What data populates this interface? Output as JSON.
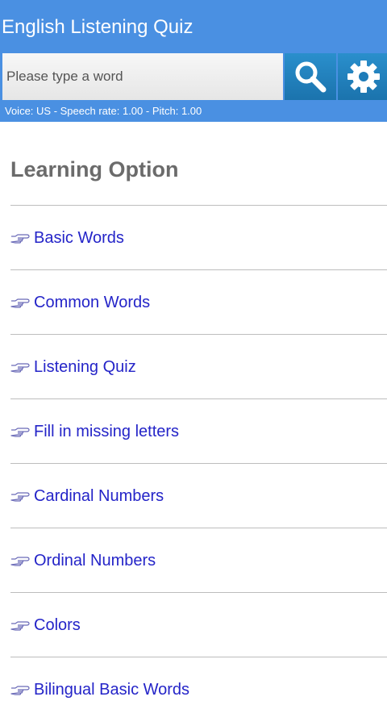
{
  "app": {
    "title": "English Listening Quiz"
  },
  "search": {
    "placeholder": "Please type a word",
    "value": ""
  },
  "status": "Voice: US - Speech rate: 1.00 - Pitch: 1.00",
  "section_title": "Learning Option",
  "options": [
    {
      "label": "Basic Words",
      "icon": "pointing-hand-icon"
    },
    {
      "label": "Common Words",
      "icon": "pointing-hand-icon"
    },
    {
      "label": "Listening Quiz",
      "icon": "pointing-hand-icon"
    },
    {
      "label": "Fill in missing letters",
      "icon": "pointing-hand-icon"
    },
    {
      "label": "Cardinal Numbers",
      "icon": "pointing-hand-icon"
    },
    {
      "label": "Ordinal Numbers",
      "icon": "pointing-hand-icon"
    },
    {
      "label": "Colors",
      "icon": "pointing-hand-icon"
    },
    {
      "label": "Bilingual Basic Words",
      "icon": "pointing-hand-icon"
    }
  ],
  "colors": {
    "header": "#4a90e2",
    "button": "#1b73ad",
    "link": "#2424c8",
    "section_title": "#6b6b6b"
  }
}
